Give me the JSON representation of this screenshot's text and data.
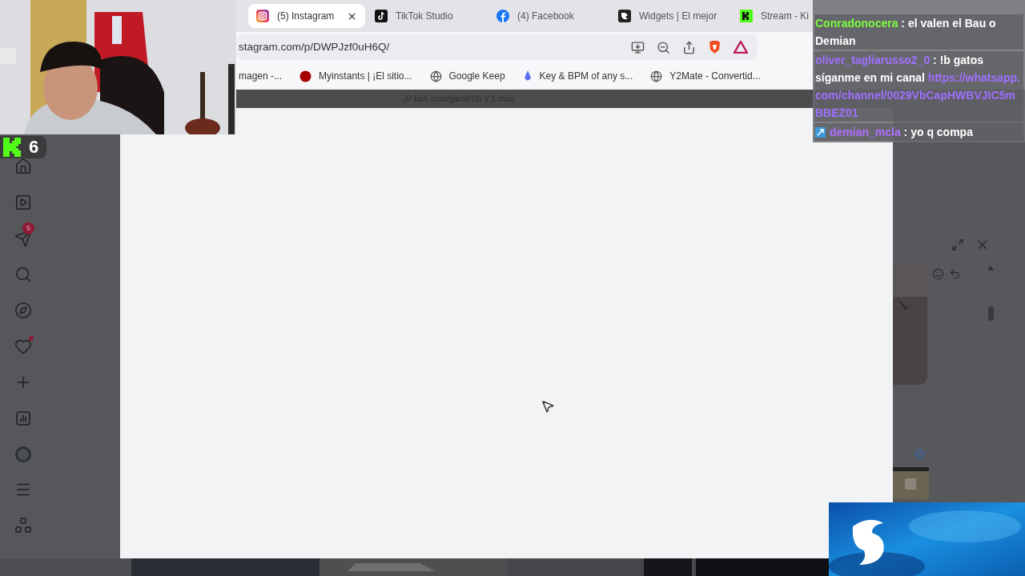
{
  "browser": {
    "tabs": [
      {
        "label": "(5) Instagram",
        "kind": "instagram",
        "selected": true
      },
      {
        "label": "TikTok Studio",
        "kind": "tiktok",
        "selected": false
      },
      {
        "label": "(4) Facebook",
        "kind": "facebook",
        "selected": false
      },
      {
        "label": "Widgets | El mejor",
        "kind": "widgets",
        "selected": false
      },
      {
        "label": "Stream - Ki",
        "kind": "kick",
        "selected": false
      }
    ],
    "address": {
      "value": "stagram.com/p/DWPJzf0uH6Q/"
    },
    "bookmarks": [
      {
        "label": "magen -...",
        "kind": "none"
      },
      {
        "label": "Myinstants | ¡El sitio...",
        "kind": "dot"
      },
      {
        "label": "Google Keep",
        "kind": "globe"
      },
      {
        "label": "Key & BPM of any s...",
        "kind": "drop"
      },
      {
        "label": "Y2Mate - Convertid...",
        "kind": "globe"
      }
    ],
    "status_link": "kick.com/garab1to y 1 más"
  },
  "sidebar": {
    "items": [
      {
        "kind": "home"
      },
      {
        "kind": "reels"
      },
      {
        "kind": "messages",
        "badge": "5"
      },
      {
        "kind": "search"
      },
      {
        "kind": "explore"
      },
      {
        "kind": "notifications",
        "dot": true
      },
      {
        "kind": "create"
      },
      {
        "kind": "insights"
      },
      {
        "kind": "profile"
      }
    ],
    "bottom_items": [
      {
        "kind": "menu"
      },
      {
        "kind": "apps"
      }
    ]
  },
  "viewer_count": "6",
  "chat": [
    {
      "user": "Conradonocera",
      "color": "#7dfc3e",
      "text": ": el valen el Bau o Demian"
    },
    {
      "user": "oliver_tagliarusso2_0",
      "color": "#a070ff",
      "text": ": !b gatos síganme en mi canal",
      "link": "https://whatsapp.com/channel/0029VbCapHWBVJIC5mBBEZ01"
    },
    {
      "user": "demian_mcla",
      "color": "#b070ff",
      "text": ": yo q compa",
      "badge": true
    }
  ]
}
